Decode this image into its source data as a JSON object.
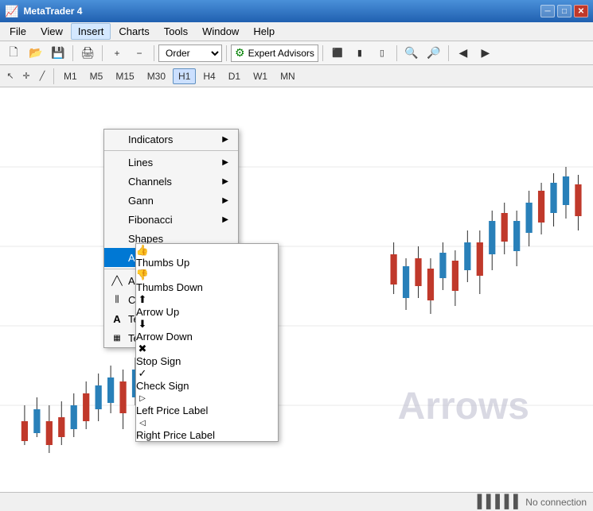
{
  "titleBar": {
    "title": "MetaTrader 4",
    "controls": [
      "minimize",
      "maximize",
      "close"
    ]
  },
  "menuBar": {
    "items": [
      "File",
      "View",
      "Insert",
      "Charts",
      "Tools",
      "Window",
      "Help"
    ],
    "activeItem": "Insert"
  },
  "toolbar": {
    "buttons": [
      "new",
      "open",
      "save",
      "print",
      "separator",
      "cut",
      "copy",
      "paste",
      "separator",
      "zoom-in",
      "zoom-out"
    ],
    "expertAdvisors": "Expert Advisors"
  },
  "timeframes": {
    "items": [
      "M1",
      "M5",
      "M15",
      "M30",
      "H1",
      "H4",
      "D1",
      "W1",
      "MN"
    ],
    "active": "H1"
  },
  "insertMenu": {
    "items": [
      {
        "label": "Indicators",
        "hasSubmenu": true
      },
      {
        "label": "separator"
      },
      {
        "label": "Lines",
        "hasSubmenu": true
      },
      {
        "label": "Channels",
        "hasSubmenu": true
      },
      {
        "label": "Gann",
        "hasSubmenu": true
      },
      {
        "label": "Fibonacci",
        "hasSubmenu": true
      },
      {
        "label": "Shapes",
        "hasSubmenu": false
      },
      {
        "label": "Arrows",
        "hasSubmenu": true,
        "active": true
      },
      {
        "label": "separator"
      },
      {
        "label": "Andrews' Pitchfork",
        "hasSubmenu": false,
        "icon": "pitchfork"
      },
      {
        "label": "Cycle Lines",
        "hasSubmenu": false,
        "icon": "cycle"
      },
      {
        "label": "Text",
        "hasSubmenu": false,
        "icon": "text-A"
      },
      {
        "label": "Text Label",
        "hasSubmenu": false,
        "icon": "text-label"
      }
    ]
  },
  "arrowsSubmenu": {
    "items": [
      {
        "label": "Thumbs Up",
        "icon": "👍"
      },
      {
        "label": "Thumbs Down",
        "icon": "👎"
      },
      {
        "label": "Arrow Up",
        "icon": "⬆"
      },
      {
        "label": "Arrow Down",
        "icon": "⬇"
      },
      {
        "label": "Stop Sign",
        "icon": "🛑"
      },
      {
        "label": "Check Sign",
        "icon": "✓"
      },
      {
        "label": "Left Price Label",
        "icon": "▷"
      },
      {
        "label": "Right Price Label",
        "icon": "◁"
      }
    ]
  },
  "chart": {
    "watermark": "Arrows"
  },
  "statusBar": {
    "left": "",
    "right": "No connection",
    "icon": "bars"
  }
}
